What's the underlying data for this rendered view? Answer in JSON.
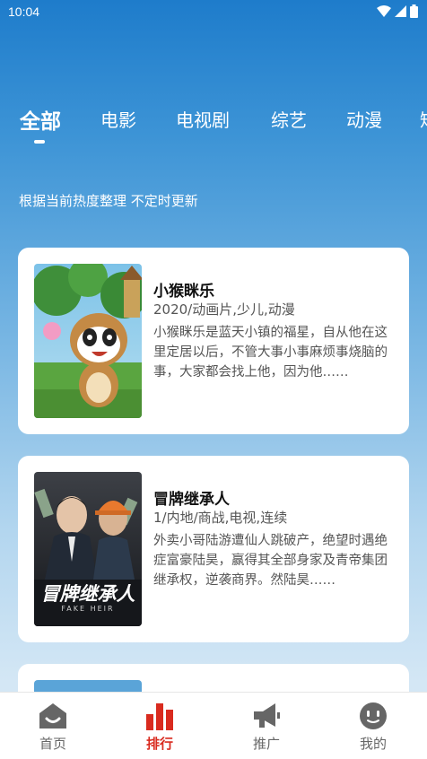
{
  "status_bar": {
    "time": "10:04"
  },
  "tabs": [
    {
      "label": "全部",
      "active": true
    },
    {
      "label": "电影"
    },
    {
      "label": "电视剧"
    },
    {
      "label": "综艺"
    },
    {
      "label": "动漫"
    },
    {
      "label": "短"
    }
  ],
  "subtitle": "根据当前热度整理 不定时更新",
  "items": [
    {
      "title": "小猴眯乐",
      "meta": "2020/动画片,少儿,动漫",
      "desc": "小猴眯乐是蓝天小镇的福星，自从他在这里定居以后，不管大事小事麻烦事烧脑的事，大家都会找上他，因为他……"
    },
    {
      "title": "冒牌继承人",
      "meta": "1/内地/商战,电视,连续",
      "desc": "外卖小哥陆游遭仙人跳破产，绝望时遇绝症富豪陆昊，赢得其全部身家及青帝集团继承权，逆袭商界。然陆昊……",
      "poster_title": "冒牌继承人",
      "poster_subtitle": "FAKE HEIR"
    }
  ],
  "bottom_nav": [
    {
      "label": "首页",
      "icon": "home-icon"
    },
    {
      "label": "排行",
      "icon": "ranking-icon",
      "active": true
    },
    {
      "label": "推广",
      "icon": "megaphone-icon"
    },
    {
      "label": "我的",
      "icon": "profile-icon"
    }
  ],
  "colors": {
    "accent": "#d92b1f",
    "nav_icon": "#666666",
    "header_blue": "#1e7ccb"
  }
}
